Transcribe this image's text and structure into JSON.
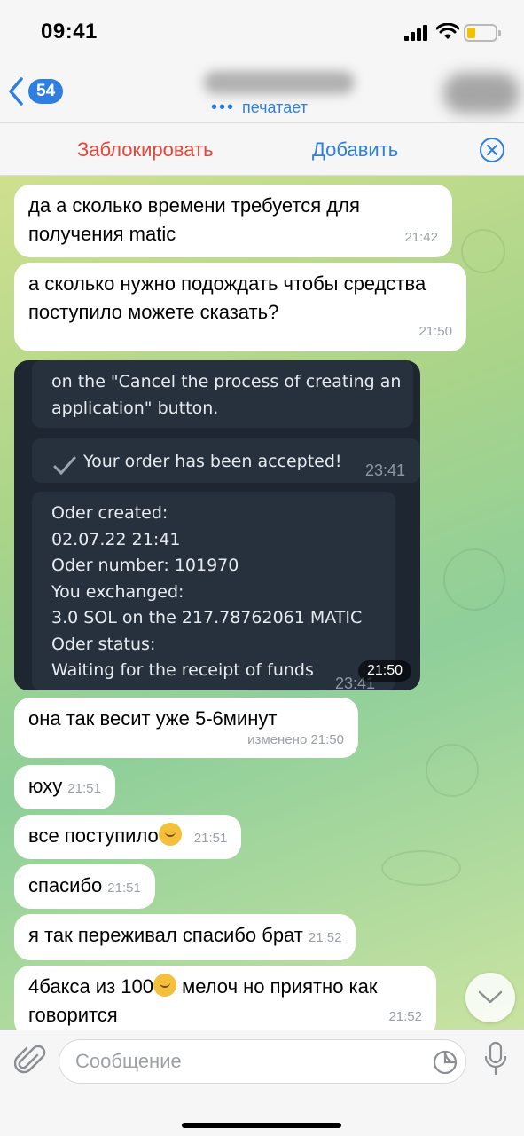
{
  "status_bar": {
    "time": "09:41"
  },
  "header": {
    "back_count": "54",
    "status_dots": "•••",
    "status": "печатает"
  },
  "action_bar": {
    "block_label": "Заблокировать",
    "add_label": "Добавить"
  },
  "messages": [
    {
      "text": "да а сколько времени требуется для получения matic",
      "time": "21:42"
    },
    {
      "text": "а сколько нужно подождать чтобы средства поступило можете сказать?",
      "time": "21:50"
    },
    {
      "text": "она так весит уже 5-6минут",
      "time": "изменено 21:50"
    },
    {
      "text": "юху",
      "time": "21:51"
    },
    {
      "text": "все поступило",
      "time": "21:51"
    },
    {
      "text": "спасибо",
      "time": "21:51"
    },
    {
      "text": "я так переживал спасибо брат",
      "time": "21:52"
    },
    {
      "text_a": "4бакса из 100",
      "text_b": " мелоч но приятно как говорится",
      "time": "21:52"
    }
  ],
  "screenshot": {
    "top_line1": "on the \"Cancel the process of creating an",
    "top_line2": "application\" button.",
    "accepted": "Your order has been accepted!",
    "accepted_time": "23:41",
    "lines": [
      "Oder created:",
      "02.07.22 21:41",
      "Oder number: 101970",
      "You exchanged:",
      "3.0 SOL on the  217.78762061 MATIC",
      "Oder status:",
      "Waiting for the receipt of funds"
    ],
    "inner_time": "23:41",
    "time": "21:50"
  },
  "input": {
    "placeholder": "Сообщение"
  },
  "colors": {
    "accent": "#2f7fe0",
    "danger": "#e5473d"
  }
}
